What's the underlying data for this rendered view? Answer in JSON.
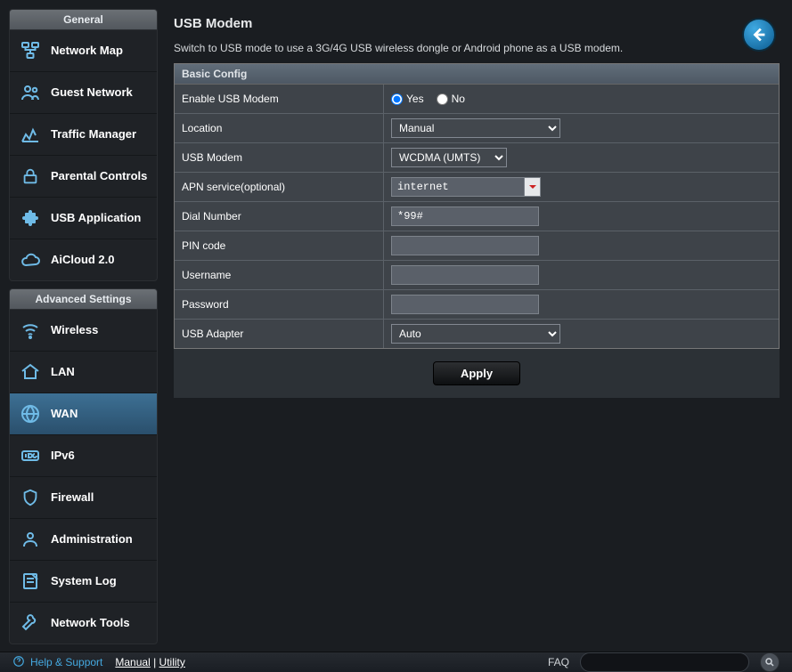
{
  "sidebar": {
    "general": {
      "title": "General",
      "items": [
        {
          "label": "Network Map",
          "icon": "network-map"
        },
        {
          "label": "Guest Network",
          "icon": "guest"
        },
        {
          "label": "Traffic Manager",
          "icon": "traffic"
        },
        {
          "label": "Parental Controls",
          "icon": "lock"
        },
        {
          "label": "USB Application",
          "icon": "puzzle"
        },
        {
          "label": "AiCloud 2.0",
          "icon": "cloud"
        }
      ]
    },
    "advanced": {
      "title": "Advanced Settings",
      "items": [
        {
          "label": "Wireless",
          "icon": "wifi"
        },
        {
          "label": "LAN",
          "icon": "home"
        },
        {
          "label": "WAN",
          "icon": "globe",
          "active": true
        },
        {
          "label": "IPv6",
          "icon": "ipv6"
        },
        {
          "label": "Firewall",
          "icon": "shield"
        },
        {
          "label": "Administration",
          "icon": "admin"
        },
        {
          "label": "System Log",
          "icon": "log"
        },
        {
          "label": "Network Tools",
          "icon": "tools"
        }
      ]
    }
  },
  "page": {
    "title": "USB Modem",
    "desc": "Switch to USB mode to use a 3G/4G USB wireless dongle or Android phone as a USB modem."
  },
  "panel": {
    "title": "Basic Config"
  },
  "form": {
    "enable_label": "Enable USB Modem",
    "yes": "Yes",
    "no": "No",
    "enable_value": "yes",
    "location_label": "Location",
    "location_value": "Manual",
    "modem_label": "USB Modem",
    "modem_value": "WCDMA (UMTS)",
    "apn_label": "APN service(optional)",
    "apn_value": "internet",
    "dial_label": "Dial Number",
    "dial_value": "*99#",
    "pin_label": "PIN code",
    "pin_value": "",
    "user_label": "Username",
    "user_value": "",
    "pass_label": "Password",
    "pass_value": "",
    "adapter_label": "USB Adapter",
    "adapter_value": "Auto",
    "apply": "Apply"
  },
  "footer": {
    "help": "Help & Support",
    "manual": "Manual",
    "utility": "Utility",
    "faq": "FAQ"
  }
}
